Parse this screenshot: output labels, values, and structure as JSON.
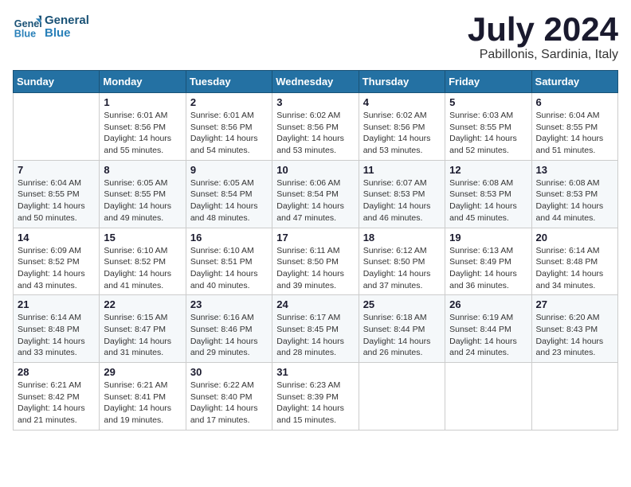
{
  "header": {
    "logo": {
      "line1": "General",
      "line2": "Blue"
    },
    "title": "July 2024",
    "subtitle": "Pabillonis, Sardinia, Italy"
  },
  "weekdays": [
    "Sunday",
    "Monday",
    "Tuesday",
    "Wednesday",
    "Thursday",
    "Friday",
    "Saturday"
  ],
  "weeks": [
    [
      null,
      {
        "day": 1,
        "sunrise": "6:01 AM",
        "sunset": "8:56 PM",
        "daylight": "14 hours and 55 minutes."
      },
      {
        "day": 2,
        "sunrise": "6:01 AM",
        "sunset": "8:56 PM",
        "daylight": "14 hours and 54 minutes."
      },
      {
        "day": 3,
        "sunrise": "6:02 AM",
        "sunset": "8:56 PM",
        "daylight": "14 hours and 53 minutes."
      },
      {
        "day": 4,
        "sunrise": "6:02 AM",
        "sunset": "8:56 PM",
        "daylight": "14 hours and 53 minutes."
      },
      {
        "day": 5,
        "sunrise": "6:03 AM",
        "sunset": "8:55 PM",
        "daylight": "14 hours and 52 minutes."
      },
      {
        "day": 6,
        "sunrise": "6:04 AM",
        "sunset": "8:55 PM",
        "daylight": "14 hours and 51 minutes."
      }
    ],
    [
      {
        "day": 7,
        "sunrise": "6:04 AM",
        "sunset": "8:55 PM",
        "daylight": "14 hours and 50 minutes."
      },
      {
        "day": 8,
        "sunrise": "6:05 AM",
        "sunset": "8:55 PM",
        "daylight": "14 hours and 49 minutes."
      },
      {
        "day": 9,
        "sunrise": "6:05 AM",
        "sunset": "8:54 PM",
        "daylight": "14 hours and 48 minutes."
      },
      {
        "day": 10,
        "sunrise": "6:06 AM",
        "sunset": "8:54 PM",
        "daylight": "14 hours and 47 minutes."
      },
      {
        "day": 11,
        "sunrise": "6:07 AM",
        "sunset": "8:53 PM",
        "daylight": "14 hours and 46 minutes."
      },
      {
        "day": 12,
        "sunrise": "6:08 AM",
        "sunset": "8:53 PM",
        "daylight": "14 hours and 45 minutes."
      },
      {
        "day": 13,
        "sunrise": "6:08 AM",
        "sunset": "8:53 PM",
        "daylight": "14 hours and 44 minutes."
      }
    ],
    [
      {
        "day": 14,
        "sunrise": "6:09 AM",
        "sunset": "8:52 PM",
        "daylight": "14 hours and 43 minutes."
      },
      {
        "day": 15,
        "sunrise": "6:10 AM",
        "sunset": "8:52 PM",
        "daylight": "14 hours and 41 minutes."
      },
      {
        "day": 16,
        "sunrise": "6:10 AM",
        "sunset": "8:51 PM",
        "daylight": "14 hours and 40 minutes."
      },
      {
        "day": 17,
        "sunrise": "6:11 AM",
        "sunset": "8:50 PM",
        "daylight": "14 hours and 39 minutes."
      },
      {
        "day": 18,
        "sunrise": "6:12 AM",
        "sunset": "8:50 PM",
        "daylight": "14 hours and 37 minutes."
      },
      {
        "day": 19,
        "sunrise": "6:13 AM",
        "sunset": "8:49 PM",
        "daylight": "14 hours and 36 minutes."
      },
      {
        "day": 20,
        "sunrise": "6:14 AM",
        "sunset": "8:48 PM",
        "daylight": "14 hours and 34 minutes."
      }
    ],
    [
      {
        "day": 21,
        "sunrise": "6:14 AM",
        "sunset": "8:48 PM",
        "daylight": "14 hours and 33 minutes."
      },
      {
        "day": 22,
        "sunrise": "6:15 AM",
        "sunset": "8:47 PM",
        "daylight": "14 hours and 31 minutes."
      },
      {
        "day": 23,
        "sunrise": "6:16 AM",
        "sunset": "8:46 PM",
        "daylight": "14 hours and 29 minutes."
      },
      {
        "day": 24,
        "sunrise": "6:17 AM",
        "sunset": "8:45 PM",
        "daylight": "14 hours and 28 minutes."
      },
      {
        "day": 25,
        "sunrise": "6:18 AM",
        "sunset": "8:44 PM",
        "daylight": "14 hours and 26 minutes."
      },
      {
        "day": 26,
        "sunrise": "6:19 AM",
        "sunset": "8:44 PM",
        "daylight": "14 hours and 24 minutes."
      },
      {
        "day": 27,
        "sunrise": "6:20 AM",
        "sunset": "8:43 PM",
        "daylight": "14 hours and 23 minutes."
      }
    ],
    [
      {
        "day": 28,
        "sunrise": "6:21 AM",
        "sunset": "8:42 PM",
        "daylight": "14 hours and 21 minutes."
      },
      {
        "day": 29,
        "sunrise": "6:21 AM",
        "sunset": "8:41 PM",
        "daylight": "14 hours and 19 minutes."
      },
      {
        "day": 30,
        "sunrise": "6:22 AM",
        "sunset": "8:40 PM",
        "daylight": "14 hours and 17 minutes."
      },
      {
        "day": 31,
        "sunrise": "6:23 AM",
        "sunset": "8:39 PM",
        "daylight": "14 hours and 15 minutes."
      },
      null,
      null,
      null
    ]
  ]
}
